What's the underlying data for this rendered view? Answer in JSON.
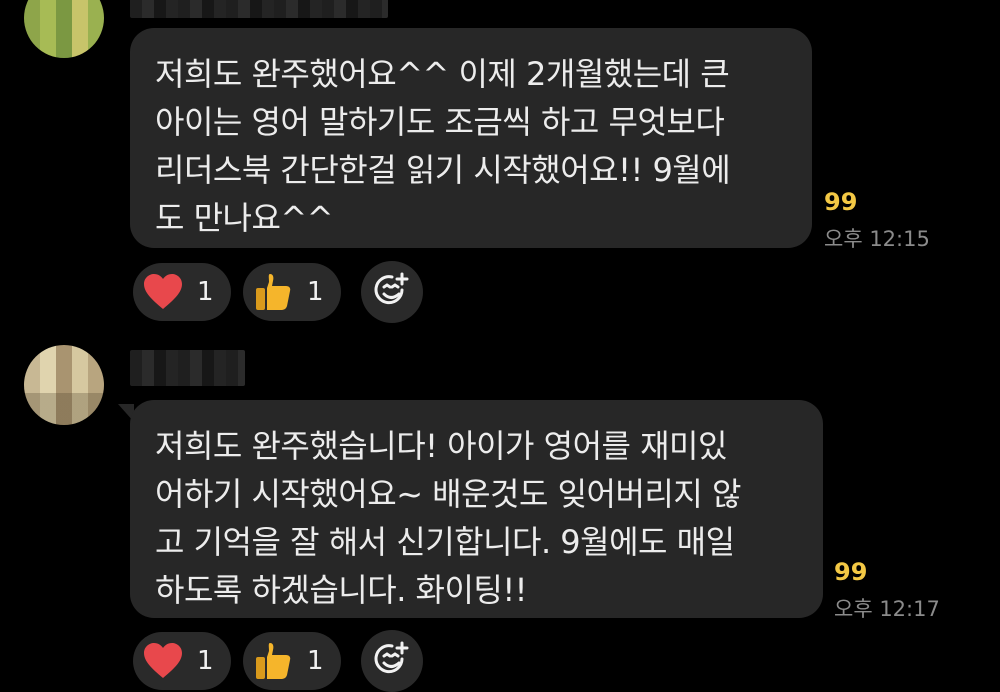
{
  "messages": [
    {
      "lines": [
        "저희도 완주했어요^^ 이제 2개월했는데 큰",
        "아이는 영어 말하기도 조금씩 하고 무엇보다",
        "리더스북 간단한걸 읽기 시작했어요!! 9월에",
        "도 만나요^^"
      ],
      "unread_count": "99",
      "time": "오후 12:15",
      "reactions": [
        {
          "icon": "heart-icon",
          "count": "1"
        },
        {
          "icon": "thumbs-up-icon",
          "count": "1"
        }
      ]
    },
    {
      "lines": [
        "저희도 완주했습니다! 아이가 영어를 재미있",
        "어하기 시작했어요~ 배운것도 잊어버리지 않",
        "고 기억을 잘 해서 신기합니다. 9월에도 매일",
        "하도록 하겠습니다. 화이팅!!"
      ],
      "unread_count": "99",
      "time": "오후 12:17",
      "reactions": [
        {
          "icon": "heart-icon",
          "count": "1"
        },
        {
          "icon": "thumbs-up-icon",
          "count": "1"
        }
      ]
    }
  ],
  "colors": {
    "background": "#000000",
    "bubble": "#272727",
    "unread": "#f3c845",
    "time": "#8b8b8b",
    "heart": "#e8484c",
    "thumb": "#f5b52b"
  },
  "icons": {
    "add_reaction": "add-reaction-icon"
  }
}
